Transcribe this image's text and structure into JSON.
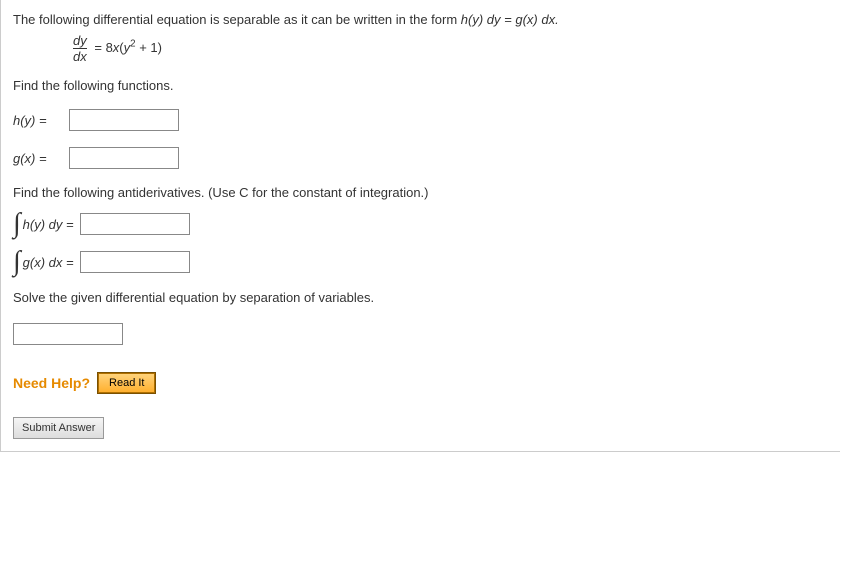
{
  "intro": {
    "line1_pre": "The following differential equation is separable as it can be written in the form ",
    "line1_form": "h(y) dy = g(x) dx.",
    "frac_num": "dy",
    "frac_den": "dx",
    "rhs_pre": " = 8",
    "rhs_x": "x",
    "rhs_open": "(",
    "rhs_y": "y",
    "rhs_exp": "2",
    "rhs_post": " + 1)"
  },
  "sections": {
    "find_functions": "Find the following functions.",
    "find_antiderivatives": "Find the following antiderivatives. (Use C for the constant of integration.)",
    "solve": "Solve the given differential equation by separation of variables."
  },
  "labels": {
    "hy": "h(y)  =",
    "gx": "g(x)  =",
    "int_hy": "h(y) dy  =",
    "int_gx": "g(x) dx  ="
  },
  "help": {
    "label": "Need Help?",
    "read": "Read It"
  },
  "submit": {
    "label": "Submit Answer"
  }
}
